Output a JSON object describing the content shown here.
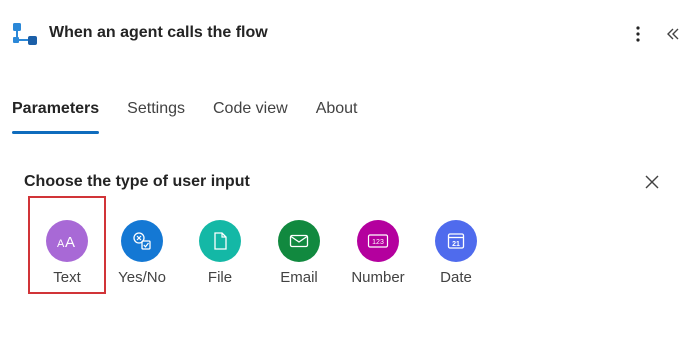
{
  "header": {
    "title": "When an agent calls the flow",
    "trigger_icon": "flow-trigger-icon",
    "more_icon": "more-vertical-icon",
    "collapse_icon": "double-chevron-left-icon"
  },
  "tabs": [
    {
      "label": "Parameters",
      "active": true
    },
    {
      "label": "Settings",
      "active": false
    },
    {
      "label": "Code view",
      "active": false
    },
    {
      "label": "About",
      "active": false
    }
  ],
  "input_picker": {
    "title": "Choose the type of user input",
    "close_icon": "close-icon",
    "types": [
      {
        "label": "Text",
        "icon": "text-icon",
        "color": "#a869d6",
        "selected": true
      },
      {
        "label": "Yes/No",
        "icon": "yes-no-icon",
        "color": "#1478d4",
        "selected": false
      },
      {
        "label": "File",
        "icon": "file-icon",
        "color": "#14b8a6",
        "selected": false
      },
      {
        "label": "Email",
        "icon": "email-icon",
        "color": "#11893f",
        "selected": false
      },
      {
        "label": "Number",
        "icon": "number-icon",
        "color": "#b4009e",
        "selected": false
      },
      {
        "label": "Date",
        "icon": "calendar-icon",
        "color": "#4f6bed",
        "selected": false
      }
    ]
  },
  "colors": {
    "tab_accent": "#0f6cbd",
    "selection_outline": "#d13438"
  }
}
